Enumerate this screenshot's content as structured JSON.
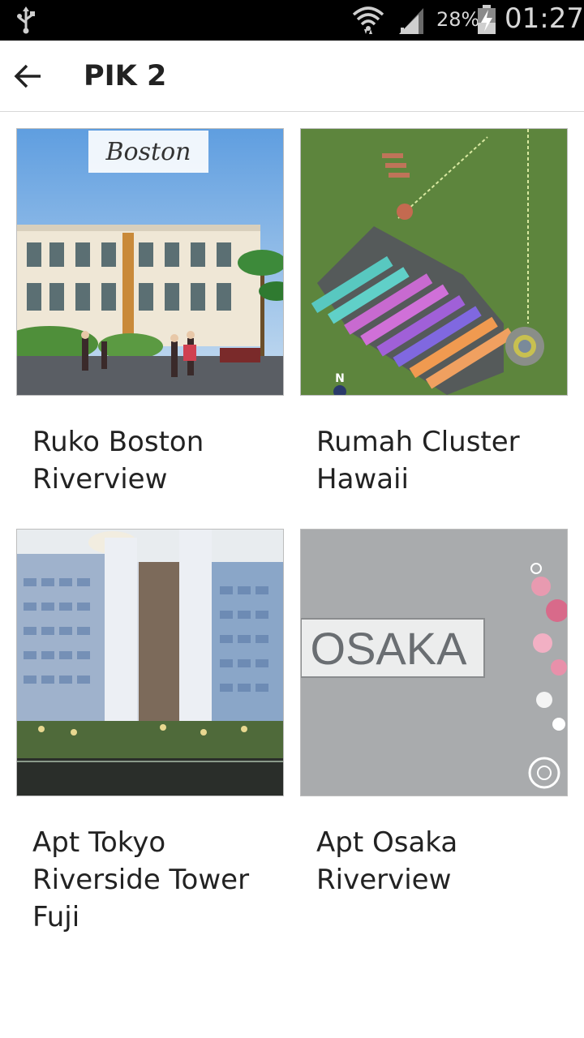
{
  "status_bar": {
    "battery_percent": "28%",
    "time": "01:27",
    "icons": [
      "usb-icon",
      "wifi-icon",
      "signal-icon",
      "battery-charging-icon"
    ]
  },
  "app_bar": {
    "title": "PIK 2",
    "back_icon": "arrow-left-icon"
  },
  "items": [
    {
      "title": "Ruko Boston Riverview",
      "image_text": "Boston"
    },
    {
      "title": "Rumah Cluster Hawaii",
      "image_text": "N"
    },
    {
      "title": "Apt Tokyo Riverside Tower Fuji"
    },
    {
      "title": "Apt Osaka Riverview",
      "image_text": "OSAKA"
    }
  ]
}
